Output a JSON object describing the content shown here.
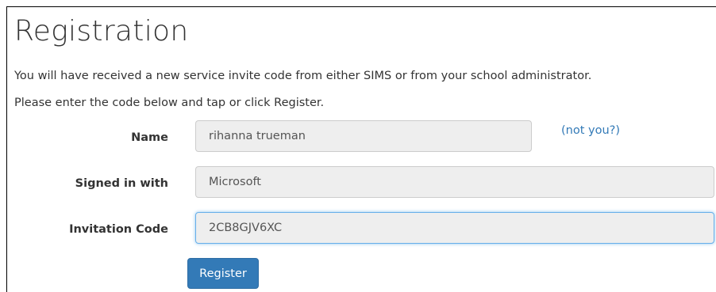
{
  "page": {
    "title": "Registration",
    "intro_line_1": "You will have received a new service invite code from either SIMS or from your school administrator.",
    "intro_line_2": "Please enter the code below and tap or click Register."
  },
  "form": {
    "name_label": "Name",
    "name_value": "rihanna trueman",
    "not_you_link": "(not you?)",
    "signed_in_label": "Signed in with",
    "signed_in_value": "Microsoft",
    "invitation_label": "Invitation Code",
    "invitation_value": "2CB8GJV6XC",
    "register_label": "Register"
  },
  "colors": {
    "link": "#337ab7",
    "primary_button": "#337ab7",
    "input_background": "#eeeeee",
    "focus_border": "#66afe9"
  }
}
